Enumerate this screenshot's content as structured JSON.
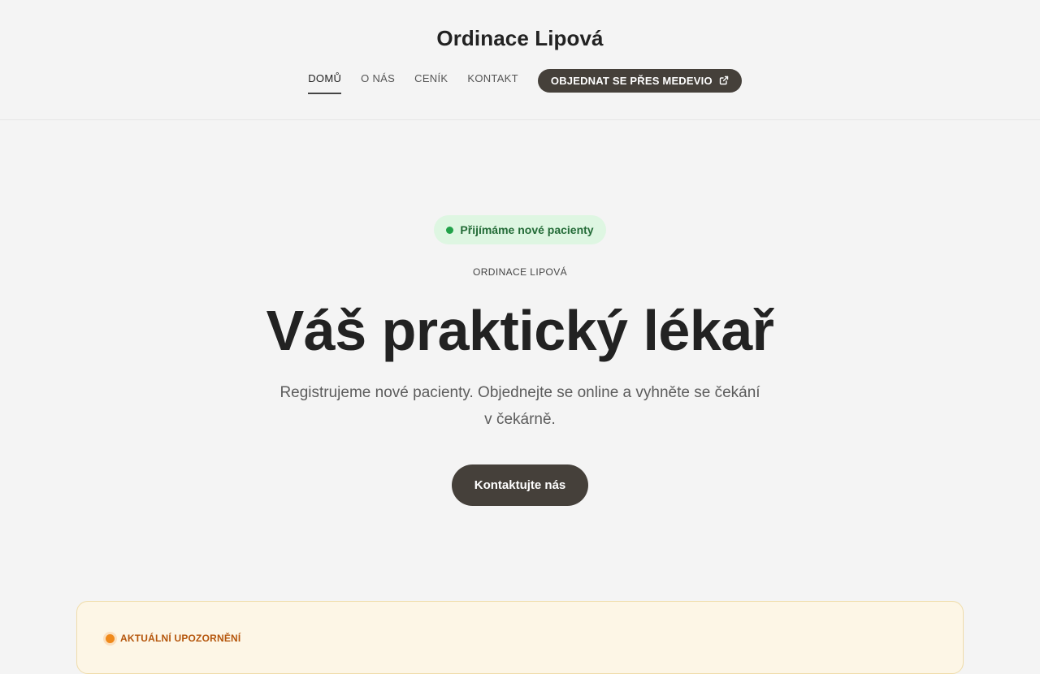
{
  "header": {
    "brand": "Ordinace Lipová",
    "nav": [
      {
        "label": "DOMŮ",
        "active": true
      },
      {
        "label": "O NÁS",
        "active": false
      },
      {
        "label": "CENÍK",
        "active": false
      },
      {
        "label": "KONTAKT",
        "active": false
      }
    ],
    "cta": {
      "label": "OBJEDNAT SE PŘES MEDEVIO",
      "icon": "external-link-icon"
    }
  },
  "hero": {
    "badge": "Přijímáme nové pacienty",
    "eyebrow": "ORDINACE LIPOVÁ",
    "title": "Váš praktický lékař",
    "subtitle": "Registrujeme nové pacienty. Objednejte se online a vyhněte se čekání v čekárně.",
    "cta_label": "Kontaktujte nás"
  },
  "notice": {
    "label": "AKTUÁLNÍ UPOZORNĚNÍ"
  },
  "colors": {
    "page_bg": "#f4f4f4",
    "dark_button": "#45403a",
    "badge_bg": "#def6e2",
    "badge_text": "#236b37",
    "badge_dot": "#22a24a",
    "notice_bg": "#fdf6e6",
    "notice_border": "#efdcaa",
    "notice_text": "#b5560c",
    "notice_dot": "#f08a1c"
  }
}
